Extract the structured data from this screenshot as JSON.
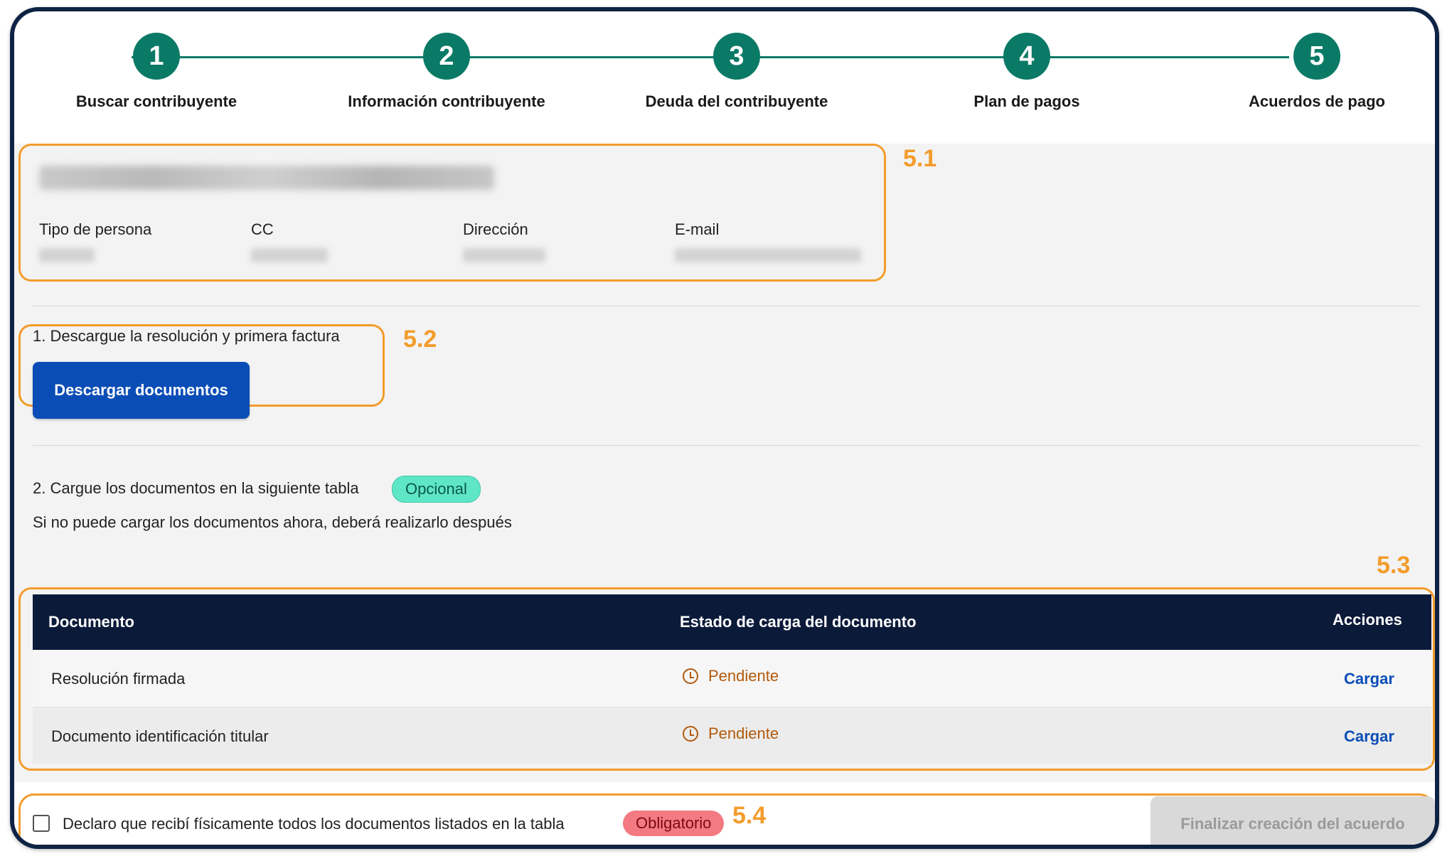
{
  "stepper": {
    "steps": [
      {
        "number": "1",
        "label": "Buscar contribuyente"
      },
      {
        "number": "2",
        "label": "Información contribuyente"
      },
      {
        "number": "3",
        "label": "Deuda del contribuyente"
      },
      {
        "number": "4",
        "label": "Plan de pagos"
      },
      {
        "number": "5",
        "label": "Acuerdos de pago"
      }
    ],
    "color": "#0a7a66"
  },
  "taxpayer": {
    "fields": [
      {
        "label": "Tipo de persona"
      },
      {
        "label": "CC"
      },
      {
        "label": "Dirección"
      },
      {
        "label": "E-mail"
      }
    ]
  },
  "annotations": [
    "5.1",
    "5.2",
    "5.3",
    "5.4"
  ],
  "section1": {
    "title": "1. Descargue la resolución y primera factura",
    "button": "Descargar documentos"
  },
  "section2": {
    "title": "2. Cargue los documentos en la siguiente tabla",
    "badge": "Opcional",
    "subtitle": "Si no puede cargar los documentos ahora, deberá realizarlo después"
  },
  "table": {
    "headers": [
      "Documento",
      "Estado de carga del documento",
      "Acciones"
    ],
    "rows": [
      {
        "document": "Resolución firmada",
        "status": "Pendiente",
        "action": "Cargar"
      },
      {
        "document": "Documento identificación titular",
        "status": "Pendiente",
        "action": "Cargar"
      }
    ]
  },
  "footer": {
    "declaration": "Declaro que recibí físicamente todos los documentos listados en la tabla",
    "badge": "Obligatorio",
    "finish_button": "Finalizar creación del acuerdo"
  },
  "colors": {
    "accent": "#f39c2b",
    "primary": "#0b4db6",
    "header": "#0c1a3a",
    "pending": "#b2590a"
  }
}
